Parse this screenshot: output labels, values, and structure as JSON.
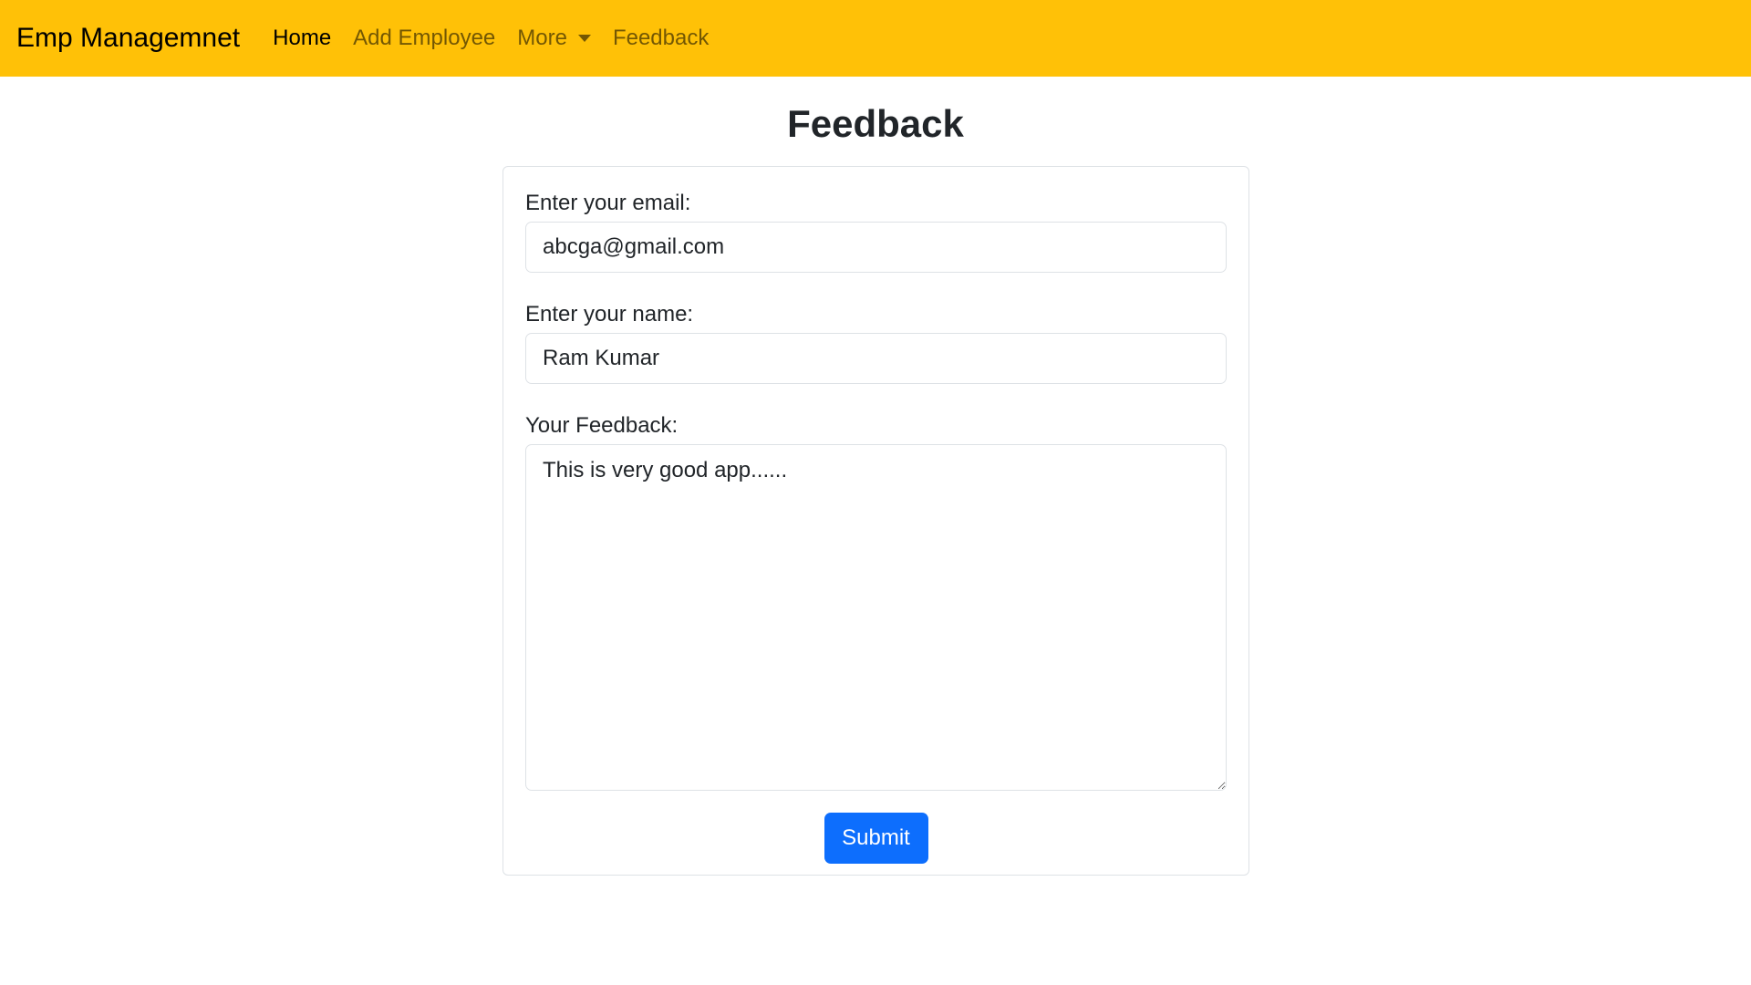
{
  "navbar": {
    "brand": "Emp Managemnet",
    "items": [
      {
        "label": "Home",
        "active": true
      },
      {
        "label": "Add Employee",
        "active": false
      },
      {
        "label": "More",
        "active": false,
        "dropdown": true
      },
      {
        "label": "Feedback",
        "active": false
      }
    ],
    "color": "#ffc107"
  },
  "page": {
    "title": "Feedback"
  },
  "form": {
    "email_label": "Enter your email:",
    "email_value": "abcga@gmail.com",
    "name_label": "Enter your name:",
    "name_value": "Ram Kumar",
    "feedback_label": "Your Feedback:",
    "feedback_value": "This is very good app......",
    "submit_label": "Submit",
    "submit_color": "#0d6efd"
  }
}
